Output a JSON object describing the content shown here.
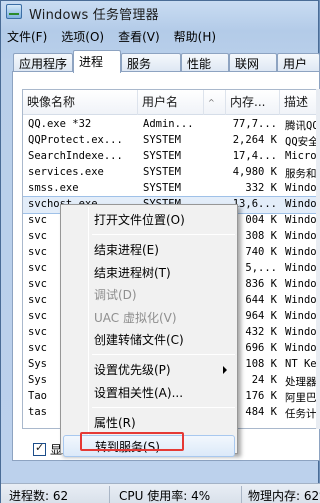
{
  "window": {
    "title": "Windows 任务管理器"
  },
  "menubar": [
    "文件(F)",
    "选项(O)",
    "查看(V)",
    "帮助(H)"
  ],
  "tabs": [
    "应用程序",
    "进程",
    "服务",
    "性能",
    "联网",
    "用户"
  ],
  "active_tab": "进程",
  "columns": [
    "映像名称",
    "用户名",
    "^",
    "内存...",
    "描述"
  ],
  "rows": [
    [
      "QQ.exe *32",
      "Admin...",
      "77,7...",
      "腾讯QQ"
    ],
    [
      "QQProtect.ex...",
      "SYSTEM",
      "2,264 K",
      "QQ安全"
    ],
    [
      "SearchIndexe...",
      "SYSTEM",
      "17,4...",
      "Micros"
    ],
    [
      "services.exe",
      "SYSTEM",
      "4,980 K",
      "服务和"
    ],
    [
      "smss.exe",
      "SYSTEM",
      "332 K",
      "Window"
    ],
    [
      "svchost.exe",
      "SYSTEM",
      "13,6...",
      "Window"
    ],
    [
      "svc",
      "",
      "004 K",
      "Window"
    ],
    [
      "svc",
      "",
      "308 K",
      "Window"
    ],
    [
      "svc",
      "",
      "740 K",
      "Window"
    ],
    [
      "svc",
      "",
      "5,...",
      "Window"
    ],
    [
      "svc",
      "",
      "836 K",
      "Window"
    ],
    [
      "svc",
      "",
      "644 K",
      "Window"
    ],
    [
      "svc",
      "",
      "964 K",
      "Window"
    ],
    [
      "svc",
      "",
      "432 K",
      "Window"
    ],
    [
      "svc",
      "",
      "696 K",
      "Window"
    ],
    [
      "Sys",
      "",
      "108 K",
      "NT Ker"
    ],
    [
      "Sys",
      "",
      "24 K",
      "处理器"
    ],
    [
      "Tao",
      "",
      "176 K",
      "阿里巴"
    ],
    [
      "tas",
      "",
      "484 K",
      "任务计"
    ]
  ],
  "selected_row": 5,
  "context_menu": [
    {
      "label": "打开文件位置(O)",
      "disabled": false
    },
    {
      "sep": true
    },
    {
      "label": "结束进程(E)",
      "disabled": false
    },
    {
      "label": "结束进程树(T)",
      "disabled": false
    },
    {
      "label": "调试(D)",
      "disabled": true
    },
    {
      "label": "UAC 虚拟化(V)",
      "disabled": true
    },
    {
      "label": "创建转储文件(C)",
      "disabled": false
    },
    {
      "sep": true
    },
    {
      "label": "设置优先级(P)",
      "disabled": false,
      "submenu": true
    },
    {
      "label": "设置相关性(A)...",
      "disabled": false
    },
    {
      "sep": true
    },
    {
      "label": "属性(R)",
      "disabled": false
    },
    {
      "label": "转到服务(S)",
      "disabled": false,
      "highlight": true
    }
  ],
  "show_all_label": "显",
  "status": {
    "processes": "进程数: 62",
    "cpu": "CPU 使用率: 4%",
    "memory": "物理内存: 62%"
  }
}
